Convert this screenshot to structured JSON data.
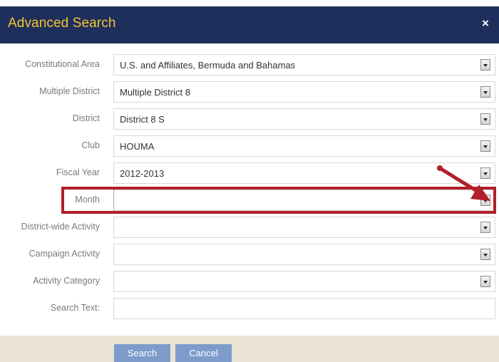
{
  "dialog": {
    "title": "Advanced Search",
    "close_label": "×"
  },
  "fields": [
    {
      "label": "Constitutional Area",
      "value": "U.S. and Affiliates, Bermuda and Bahamas"
    },
    {
      "label": "Multiple District",
      "value": "Multiple District 8"
    },
    {
      "label": "District",
      "value": "District 8 S"
    },
    {
      "label": "Club",
      "value": "HOUMA"
    },
    {
      "label": "Fiscal Year",
      "value": "2012-2013"
    },
    {
      "label": "Month",
      "value": ""
    },
    {
      "label": "District-wide Activity",
      "value": ""
    },
    {
      "label": "Campaign Activity",
      "value": ""
    },
    {
      "label": "Activity Category",
      "value": ""
    }
  ],
  "search_text": {
    "label": "Search Text:",
    "value": ""
  },
  "buttons": {
    "search": "Search",
    "cancel": "Cancel"
  },
  "colors": {
    "titlebar": "#1f2f5b",
    "title_text": "#f3c433",
    "highlight": "#b11f2a",
    "button": "#7d9ccb",
    "footer": "#e9e3d3"
  }
}
